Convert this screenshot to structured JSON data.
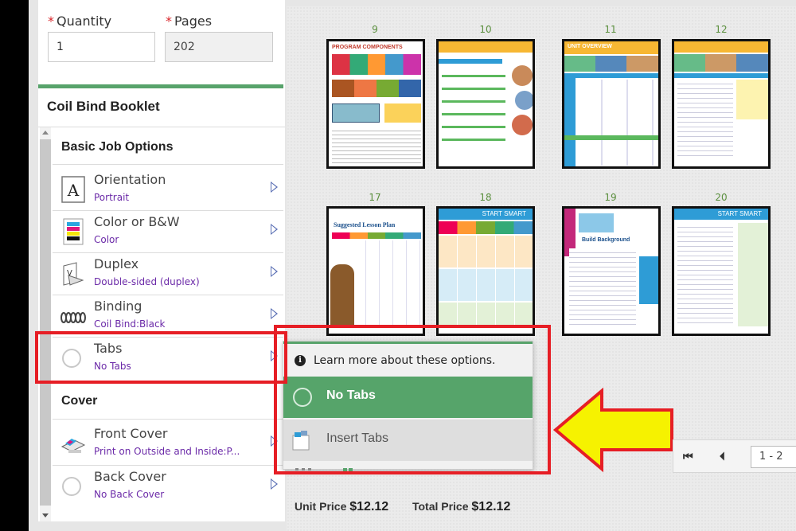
{
  "form": {
    "quantity_label": "Quantity",
    "quantity_value": "1",
    "pages_label": "Pages",
    "pages_value": "202",
    "required_mark": "*"
  },
  "product": {
    "title": "Coil Bind Booklet"
  },
  "sections": {
    "basic": "Basic Job Options",
    "cover": "Cover"
  },
  "options": [
    {
      "title": "Orientation",
      "value": "Portrait",
      "icon": "orientation-icon"
    },
    {
      "title": "Color or B&W",
      "value": "Color",
      "icon": "color-icon"
    },
    {
      "title": "Duplex",
      "value": "Double-sided (duplex)",
      "icon": "duplex-icon"
    },
    {
      "title": "Binding",
      "value": "Coil Bind:Black",
      "icon": "coil-binding-icon"
    },
    {
      "title": "Tabs",
      "value": "No Tabs",
      "icon": "radio-icon"
    }
  ],
  "cover_options": [
    {
      "title": "Front Cover",
      "value": "Print on Outside and Inside:P...",
      "icon": "printer-icon"
    },
    {
      "title": "Back Cover",
      "value": "No Back Cover",
      "icon": "radio-icon"
    }
  ],
  "popup": {
    "info_text": "Learn more about these options.",
    "options": [
      {
        "label": "No Tabs",
        "selected": true
      },
      {
        "label": "Insert Tabs",
        "selected": false
      }
    ]
  },
  "pages": {
    "row1": [
      "9",
      "10",
      "11",
      "12"
    ],
    "row2": [
      "17",
      "18",
      "19",
      "20"
    ],
    "thumb_texts": {
      "p9": "PROGRAM COMPONENTS",
      "p11": "UNIT OVERVIEW",
      "p17": "Suggested Lesson Plan",
      "p18": "START SMART",
      "p19": "Build Background",
      "p20": "START SMART"
    }
  },
  "pager": {
    "range": "1 - 2"
  },
  "price": {
    "unit_label": "Unit Price",
    "unit_value": "$12.12",
    "total_label": "Total Price",
    "total_value": "$12.12"
  },
  "colors": {
    "accent_green": "#58a36b",
    "value_purple": "#6b2aa8",
    "highlight_red": "#e61e25",
    "arrow_yellow": "#f6f200"
  }
}
